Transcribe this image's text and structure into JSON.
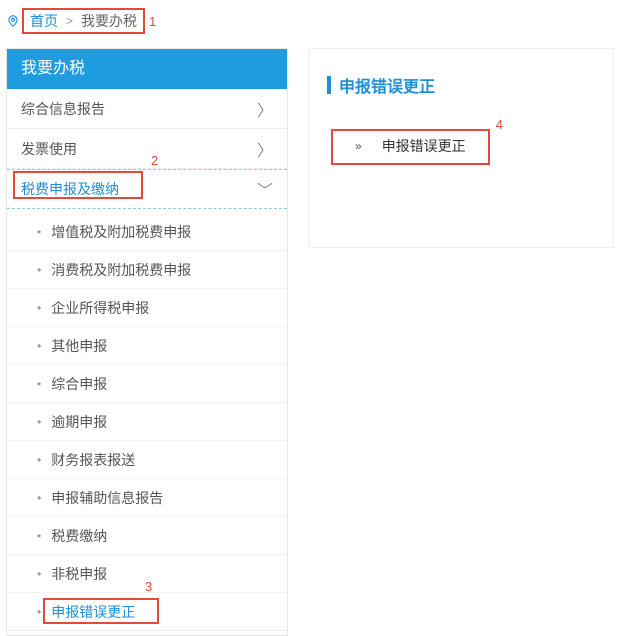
{
  "breadcrumb": {
    "home": "首页",
    "current": "我要办税"
  },
  "annotations": {
    "a1": "1",
    "a2": "2",
    "a3": "3",
    "a4": "4"
  },
  "sidebar": {
    "title": "我要办税",
    "items": [
      {
        "label": "综合信息报告"
      },
      {
        "label": "发票使用"
      }
    ],
    "activeItem": {
      "label": "税费申报及缴纳"
    },
    "subItems": [
      {
        "label": "增值税及附加税费申报"
      },
      {
        "label": "消费税及附加税费申报"
      },
      {
        "label": "企业所得税申报"
      },
      {
        "label": "其他申报"
      },
      {
        "label": "综合申报"
      },
      {
        "label": "逾期申报"
      },
      {
        "label": "财务报表报送"
      },
      {
        "label": "申报辅助信息报告"
      },
      {
        "label": "税费缴纳"
      },
      {
        "label": "非税申报"
      },
      {
        "label": "申报错误更正"
      }
    ]
  },
  "main": {
    "heading": "申报错误更正",
    "link": "申报错误更正"
  }
}
